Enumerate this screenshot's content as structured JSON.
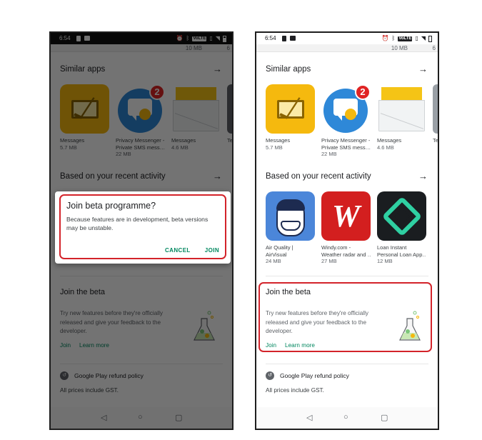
{
  "status_bar": {
    "time": "6:54",
    "volte": "VoLTE"
  },
  "top_strip": {
    "download_size": "10 MB",
    "partial_char": "6"
  },
  "similar_apps": {
    "title": "Similar apps",
    "apps": [
      {
        "name": "Messages",
        "name2": "",
        "size": "5.7 MB"
      },
      {
        "name": "Privacy Messenger -",
        "name2": "Private SMS mess…",
        "size": "22 MB",
        "badge": "2"
      },
      {
        "name": "Messages",
        "name2": "",
        "size": "4.6 MB"
      },
      {
        "name": "Te",
        "name2": "",
        "size": ""
      },
      {
        "name": "Te",
        "name2": "",
        "size": ""
      }
    ]
  },
  "recent_activity": {
    "title": "Based on your recent activity",
    "apps": [
      {
        "name": "Air Quality |",
        "name2": "AirVisual",
        "size": "24 MB"
      },
      {
        "name": "Windy.com -",
        "name2": "Weather radar and …",
        "size": "27 MB"
      },
      {
        "name": "Loan Instant",
        "name2": "Personal Loan App…",
        "size": "12 MB"
      }
    ]
  },
  "join_beta": {
    "title": "Join the beta",
    "description": "Try new features before they're officially released and give your feedback to the developer.",
    "join_label": "Join",
    "learn_more_label": "Learn more"
  },
  "refund": {
    "label": "Google Play refund policy",
    "prices_note": "All prices include GST."
  },
  "dialog": {
    "title": "Join beta programme?",
    "message": "Because features are in development, beta versions may be unstable.",
    "cancel_label": "CANCEL",
    "join_label": "JOIN"
  },
  "colors": {
    "accent_green": "#01875f",
    "highlight_red": "#d3232a"
  },
  "icons": [
    "alarm-icon",
    "bluetooth-icon",
    "vibrate-icon",
    "wifi-icon",
    "battery-icon",
    "arrow-right-icon",
    "flask-icon",
    "refund-icon",
    "back-icon",
    "home-icon",
    "recents-icon"
  ]
}
